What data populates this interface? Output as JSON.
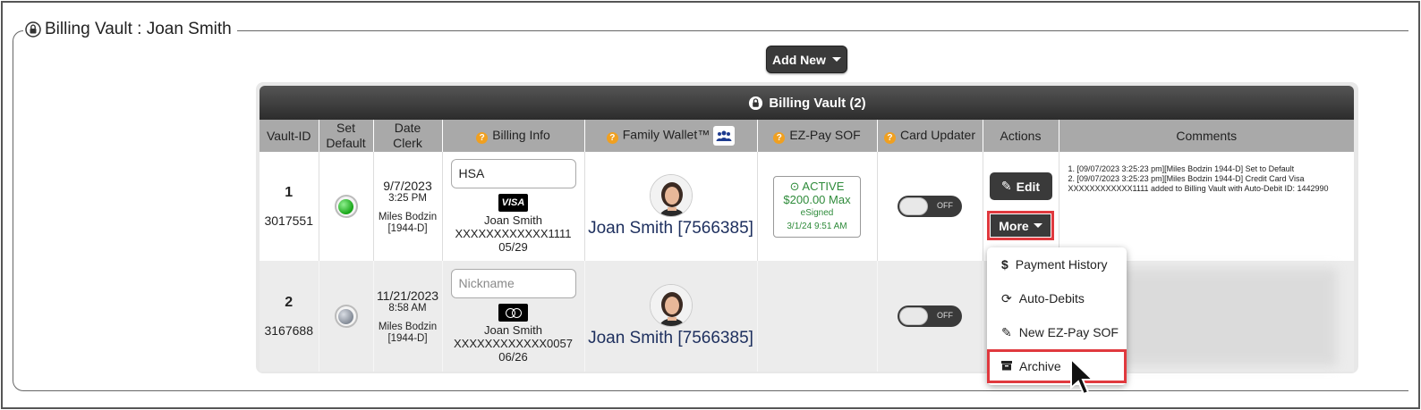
{
  "page": {
    "title": "Billing Vault : Joan Smith",
    "add_new_label": "Add New"
  },
  "vault": {
    "header": "Billing Vault (2)",
    "columns": {
      "vault_id": "Vault-ID",
      "set_default_1": "Set",
      "set_default_2": "Default",
      "date_1": "Date",
      "date_2": "Clerk",
      "billing_info": "Billing Info",
      "family_wallet": "Family Wallet™",
      "ezpay_sof": "EZ-Pay SOF",
      "card_updater": "Card Updater",
      "actions": "Actions",
      "comments": "Comments"
    },
    "rows": [
      {
        "index": "1",
        "vault_number": "3017551",
        "is_default": true,
        "date": "9/7/2023",
        "time": "3:25 PM",
        "clerk_name": "Miles Bodzin",
        "clerk_id": "[1944-D]",
        "nickname_value": "HSA",
        "card_brand": "VISA",
        "holder": "Joan Smith",
        "card_number": "XXXXXXXXXXXX1111",
        "expiry": "05/29",
        "family_name": "Joan Smith [7566385]",
        "ezpay_status": "ACTIVE",
        "ezpay_amount": "$200.00 Max",
        "ezpay_signed": "eSigned",
        "ezpay_date": "3/1/24 9:51 AM",
        "card_updater": "OFF",
        "edit_label": "Edit",
        "more_label": "More",
        "comment_1": "1. [09/07/2023 3:25:23 pm][Miles Bodzin 1944-D] Set to Default",
        "comment_2": "2. [09/07/2023 3:25:23 pm][Miles Bodzin 1944-D] Credit Card Visa",
        "comment_3": "XXXXXXXXXXXX1111 added to Billing Vault with Auto-Debit ID: 1442990"
      },
      {
        "index": "2",
        "vault_number": "3167688",
        "is_default": false,
        "date": "11/21/2023",
        "time": "8:58 AM",
        "clerk_name": "Miles Bodzin",
        "clerk_id": "[1944-D]",
        "nickname_placeholder": "Nickname",
        "card_brand": "mastercard",
        "holder": "Joan Smith",
        "card_number": "XXXXXXXXXXXX0057",
        "expiry": "06/26",
        "family_name": "Joan Smith [7566385]",
        "card_updater": "OFF"
      }
    ]
  },
  "more_menu": {
    "items": [
      {
        "label": "Payment History",
        "icon": "dollar-icon"
      },
      {
        "label": "Auto-Debits",
        "icon": "refresh-icon"
      },
      {
        "label": "New EZ-Pay SOF",
        "icon": "pencil-icon"
      },
      {
        "label": "Archive",
        "icon": "archive-icon"
      }
    ]
  },
  "colors": {
    "highlight": "#e0393e",
    "ezpay_active": "#2e8b3a",
    "family_name": "#1d2f5e"
  }
}
